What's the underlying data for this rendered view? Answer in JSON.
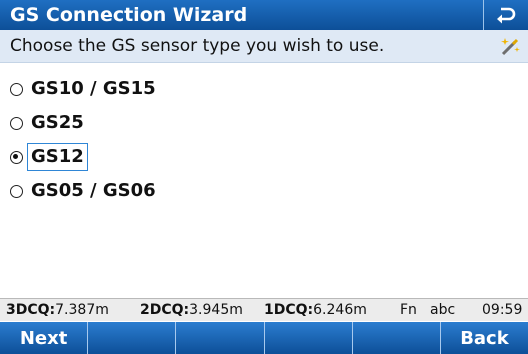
{
  "window": {
    "title": "GS Connection Wizard"
  },
  "prompt": "Choose the GS sensor type you wish to use.",
  "options": [
    {
      "label": "GS10 / GS15",
      "selected": false
    },
    {
      "label": "GS25",
      "selected": false
    },
    {
      "label": "GS12",
      "selected": true
    },
    {
      "label": "GS05 / GS06",
      "selected": false
    }
  ],
  "status": {
    "dcq3_label": "3DCQ:",
    "dcq3_value": "7.387m",
    "dcq2_label": "2DCQ:",
    "dcq2_value": "3.945m",
    "dcq1_label": "1DCQ:",
    "dcq1_value": "6.246m",
    "fn": "Fn",
    "input_mode": "abc",
    "time": "09:59"
  },
  "softkeys": {
    "next_label": "Next",
    "back_label": "Back"
  },
  "colors": {
    "title_bar": "#0d4f98",
    "subtitle_bar": "#dfe9f5",
    "focus_border": "#2f86d6"
  },
  "icons": {
    "back": "back-arrow-icon",
    "wizard": "magic-wand-icon"
  }
}
